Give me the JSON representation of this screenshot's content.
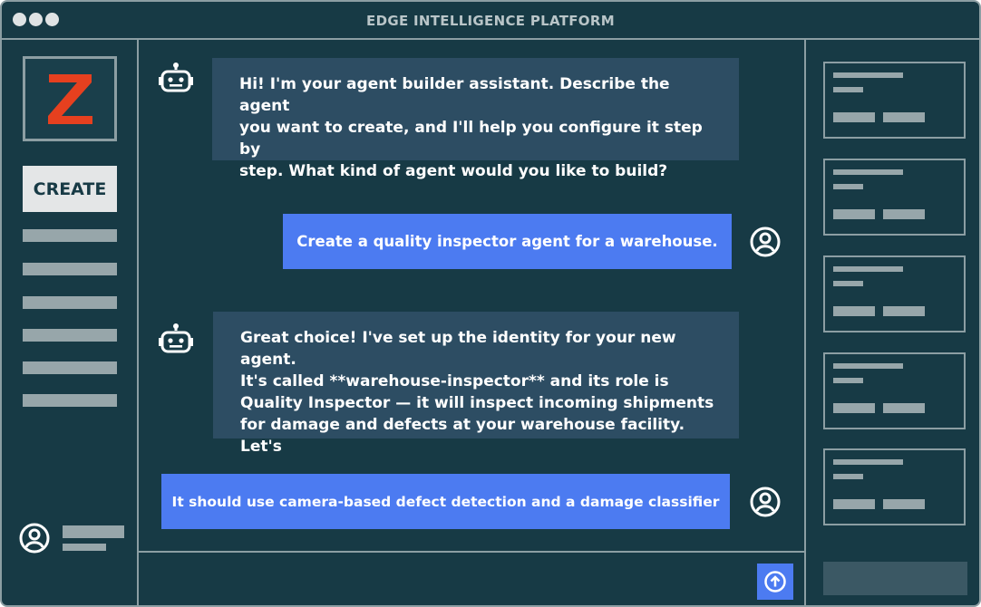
{
  "window": {
    "title": "EDGE INTELLIGENCE PLATFORM"
  },
  "colors": {
    "background": "#173a45",
    "border": "#8c9ea3",
    "bot_bubble": "#2d4d63",
    "user_bubble": "#4c7bf1",
    "logo_red": "#e6401f"
  },
  "sidebar": {
    "logo_letter": "Z",
    "create_label": "CREATE"
  },
  "messages": [
    {
      "role": "bot",
      "icon": "robot-icon",
      "lines": [
        "Hi! I'm your agent builder assistant. Describe the agent",
        "you want to create, and I'll help you configure it step by",
        "step. What kind of agent would you like to build?"
      ]
    },
    {
      "role": "user",
      "icon": "user-icon",
      "text": "Create a quality inspector agent for a warehouse."
    },
    {
      "role": "bot",
      "icon": "robot-icon",
      "lines": [
        "Great choice! I've set up the identity for your new agent.",
        "It's called **warehouse-inspector** and its role is",
        "Quality Inspector — it will inspect incoming shipments",
        "for damage and defects at your warehouse facility. Let's"
      ]
    },
    {
      "role": "user",
      "icon": "user-icon",
      "text": "It should use camera-based defect detection and a damage classifier"
    }
  ],
  "input": {
    "send_icon": "arrow-up-icon"
  }
}
